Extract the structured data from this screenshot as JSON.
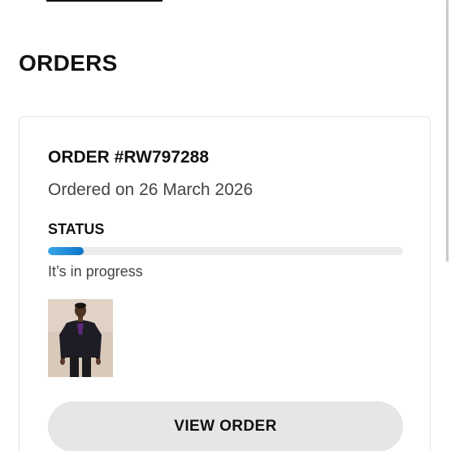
{
  "page": {
    "title": "ORDERS"
  },
  "order": {
    "id_label": "ORDER #RW797288",
    "date_label": "Ordered on 26 March 2026",
    "status_heading": "STATUS",
    "status_text": "It’s in progress",
    "progress_fraction": 0.1,
    "product_thumbnail": "person-in-dark-hoodie-photo",
    "view_button_label": "VIEW ORDER"
  },
  "colors": {
    "progress_fill": "#0a76c8",
    "progress_track": "#ebebeb",
    "button_bg": "#e6e6e6"
  }
}
